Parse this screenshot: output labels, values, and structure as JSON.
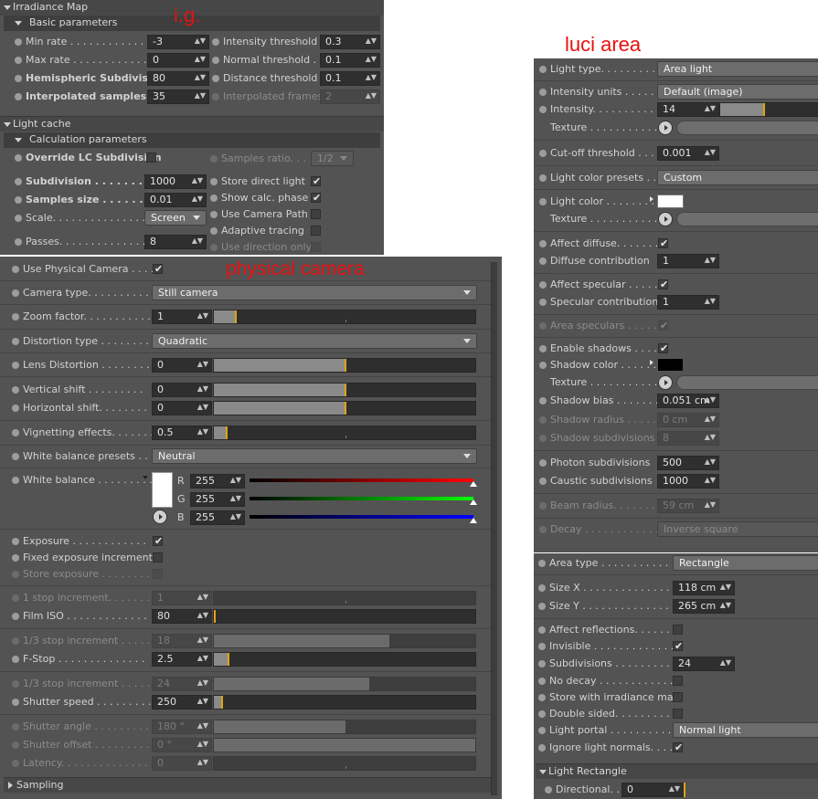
{
  "annotations": {
    "ig": "i.g.",
    "luci": "luci area",
    "physcam": "physical camera"
  },
  "irr": {
    "title": "Irradiance Map",
    "basic": "Basic parameters",
    "min_rate": "Min rate . . . . . . . . . . . . . .",
    "min_rate_v": "-3",
    "max_rate": "Max rate . . . . . . . . . . . . .",
    "max_rate_v": "0",
    "hemi": "Hemispheric Subdivision",
    "hemi_v": "80",
    "interp": "Interpolated samples . . .",
    "interp_v": "35",
    "int_thr": "Intensity threshold",
    "int_thr_v": "0.3",
    "norm_thr": "Normal threshold . .",
    "norm_thr_v": "0.1",
    "dist_thr": "Distance threshold",
    "dist_thr_v": "0.1",
    "interp_fr": "Interpolated frames",
    "interp_fr_v": "2"
  },
  "lc": {
    "title": "Light cache",
    "calc": "Calculation parameters",
    "override": "Override LC Subdivision",
    "samples_ratio": "Samples ratio. . . .",
    "samples_ratio_v": "1/2",
    "subdiv": "Subdivision . . . . . . . . .",
    "subdiv_v": "1000",
    "samples_size": "Samples size . . . . . . . . .",
    "samples_size_v": "0.01",
    "scale": "Scale. . . . . . . . . . . . . . . .",
    "scale_v": "Screen",
    "passes": "Passes. . . . . . . . . . . . . . .",
    "passes_v": "8",
    "store_direct": "Store direct light",
    "show_calc": "Show calc. phase",
    "use_cam_path": "Use Camera Path",
    "adaptive": "Adaptive tracing",
    "use_dir": "Use direction only"
  },
  "pc": {
    "use_pc": "Use Physical Camera . . . . .",
    "cam_type": "Camera type. . . . . . . . . . .",
    "cam_type_v": "Still camera",
    "zoom": "Zoom factor. . . . . . . . . . .",
    "zoom_v": "1",
    "dist_type": "Distortion type . . . . . . . .",
    "dist_type_v": "Quadratic",
    "lens_dist": "Lens Distortion . . . . . . . .",
    "lens_dist_v": "0",
    "vshift": "Vertical shift . . . . . . . . .",
    "vshift_v": "0",
    "hshift": "Horizontal shift. . . . . . . .",
    "hshift_v": "0",
    "vign": "Vignetting effects. . . . . . .",
    "vign_v": "0.5",
    "wb_presets": "White balance presets . . .",
    "wb_presets_v": "Neutral",
    "wb": "White balance . . . . . . . . .",
    "r": "R",
    "g": "G",
    "b": "B",
    "r_v": "255",
    "g_v": "255",
    "b_v": "255",
    "exposure": "Exposure . . . . . . . . . . . .",
    "fixed_exp": "Fixed exposure increments",
    "store_exp": "Store exposure . . . . . . . . .",
    "stop1": "1 stop increment. . . . . . . .",
    "stop1_v": "1",
    "iso": "Film ISO . . . . . . . . . . . . .",
    "iso_v": "80",
    "stop13a": "1/3 stop increment . . . . . .",
    "stop13a_v": "18",
    "fstop": "F-Stop . . . . . . . . . . . . . .",
    "fstop_v": "2.5",
    "stop13b": "1/3 stop increment . . . . . .",
    "stop13b_v": "24",
    "shutter": "Shutter speed . . . . . . . . .",
    "shutter_v": "250",
    "sh_angle": "Shutter angle . . . . . . . . . .",
    "sh_angle_v": "180 °",
    "sh_offset": "Shutter offset . . . . . . . . .",
    "sh_offset_v": "0 °",
    "latency": "Latency. . . . . . . . . . . . . .",
    "latency_v": "0",
    "sampling": "Sampling"
  },
  "la": {
    "light_type": "Light type. . . . . . . . . .",
    "light_type_v": "Area light",
    "int_units": "Intensity units . . . . . . .",
    "int_units_v": "Default (image)",
    "intensity": "Intensity. . . . . . . . . . .",
    "intensity_v": "14",
    "texture": "Texture . . . . . . . . . . . .",
    "cutoff": "Cut-off threshold . . .",
    "cutoff_v": "0.001",
    "lcp": "Light color presets . .",
    "lcp_v": "Custom",
    "lcolor": "Light color . . . . . . . .",
    "aff_diff": "Affect diffuse. . . . . . . .",
    "diff_contrib": "Diffuse contribution",
    "diff_contrib_v": "1",
    "aff_spec": "Affect specular . . . . . .",
    "spec_contrib": "Specular contribution",
    "spec_contrib_v": "1",
    "area_spec": "Area speculars . . . . . .",
    "en_shadows": "Enable shadows . . . .",
    "shadow_color": "Shadow color . . . . . .",
    "shadow_bias": "Shadow bias . . . . . . .",
    "shadow_bias_v": "0.051 cm",
    "shadow_radius": "Shadow radius . . . . . .",
    "shadow_radius_v": "0 cm",
    "shadow_subdiv": "Shadow subdivisions",
    "shadow_subdiv_v": "8",
    "photon": "Photon subdivisions",
    "photon_v": "500",
    "caustic": "Caustic subdivisions",
    "caustic_v": "1000",
    "beam": "Beam radius. . . . . . . .",
    "beam_v": "59 cm",
    "decay": "Decay . . . . . . . . . . . .",
    "decay_v": "Inverse square"
  },
  "ar": {
    "area_type": "Area type . . . . . . . . . . . . . .",
    "area_type_v": "Rectangle",
    "sizex": "Size X . . . . . . . . . . . . . . . .",
    "sizex_v": "118 cm",
    "sizey": "Size Y . . . . . . . . . . . . . . . .",
    "sizey_v": "265 cm",
    "aff_refl": "Affect reflections. . . . . . . .",
    "invisible": "Invisible . . . . . . . . . . . . . .",
    "subdivs": "Subdivisions . . . . . . . . . . .",
    "subdivs_v": "24",
    "no_decay": "No decay . . . . . . . . . . . . .",
    "store_irr": "Store with irradiance map",
    "double": "Double sided. . . . . . . . . . .",
    "portal": "Light portal . . . . . . . . . . .",
    "portal_v": "Normal light",
    "ignore_norm": "Ignore light normals. . . . .",
    "light_rect": "Light Rectangle",
    "directional": "Directional. . . . . .",
    "directional_v": "0"
  }
}
